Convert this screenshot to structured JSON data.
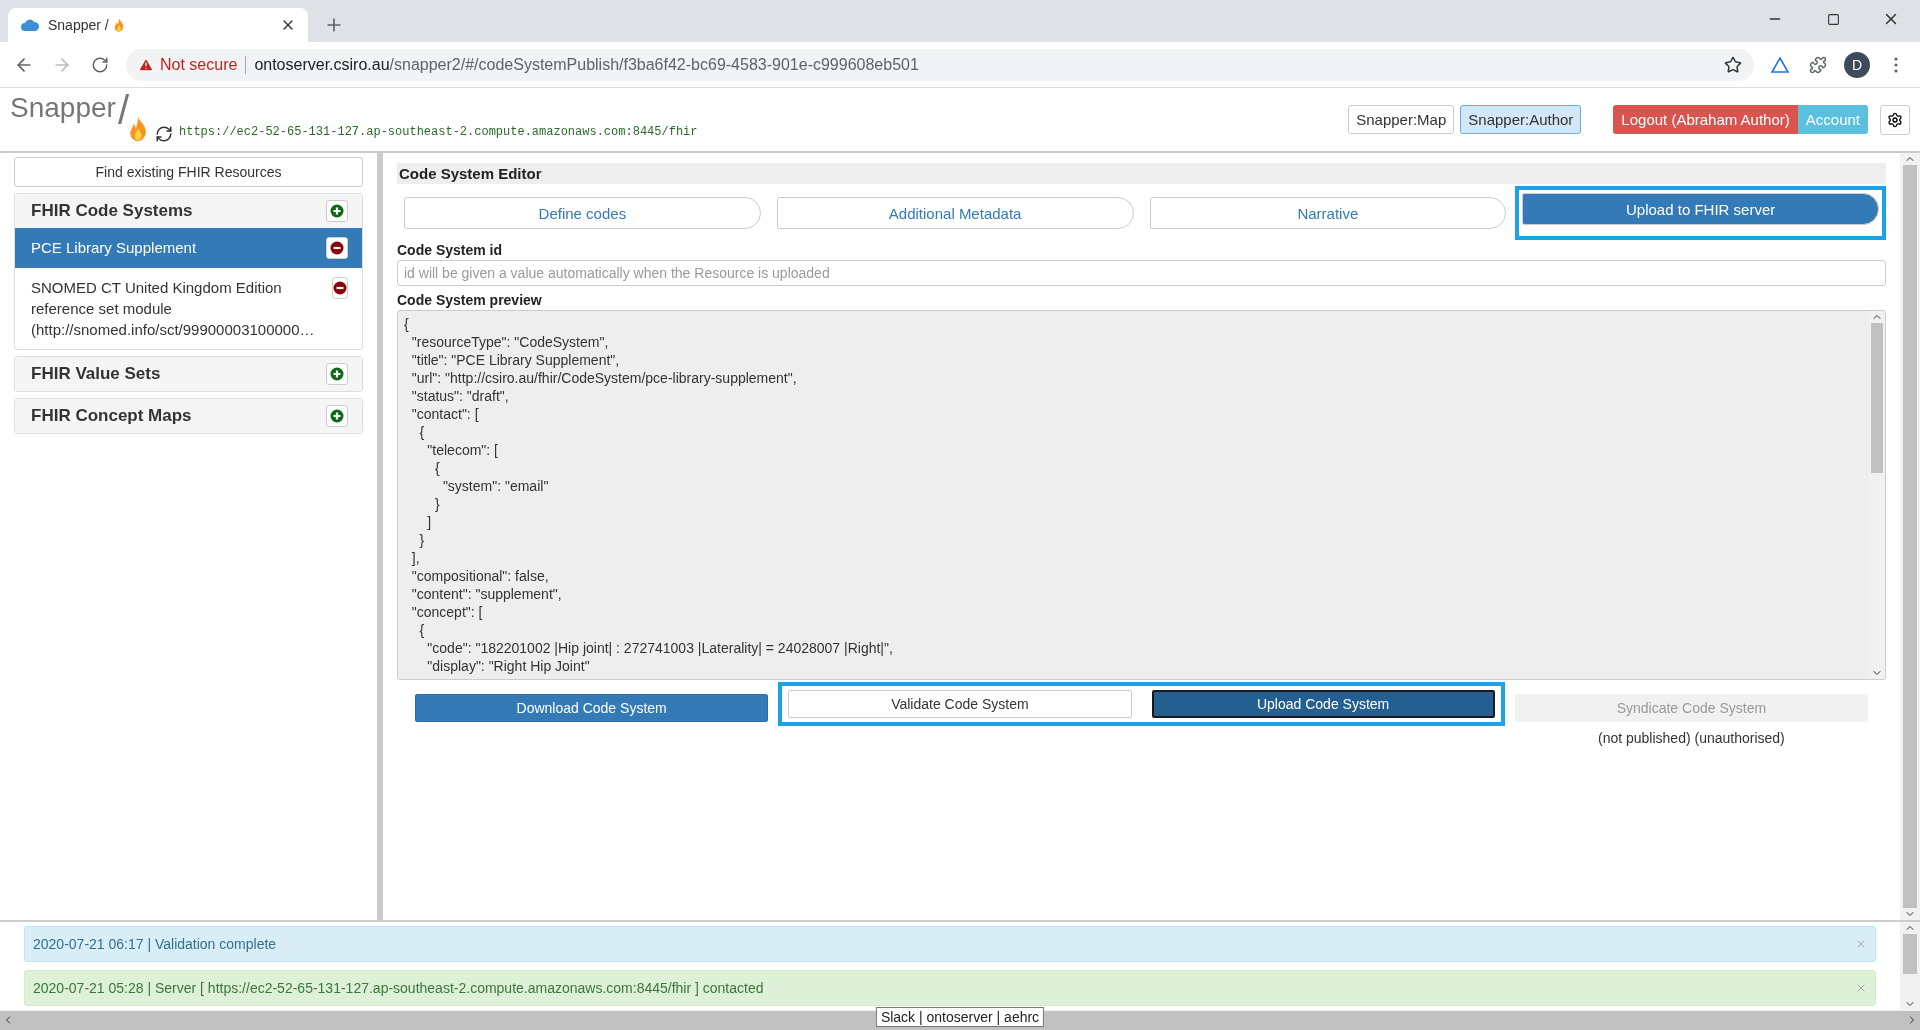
{
  "browser": {
    "tab_title": "Snapper /",
    "security": "Not secure",
    "url_host": "ontoserver.csiro.au",
    "url_path": "/snapper2/#/codeSystemPublish/f3ba6f42-bc69-4583-901e-c999608eb501",
    "profile": "D"
  },
  "header": {
    "logo": "Snapper",
    "logo_slash": "/",
    "server_url": "https://ec2-52-65-131-127.ap-southeast-2.compute.amazonaws.com:8445/fhir",
    "nav": [
      {
        "label": "Snapper:Map",
        "selected": false
      },
      {
        "label": "Snapper:Author",
        "selected": true
      }
    ],
    "logout": "Logout (Abraham Author)",
    "account": "Account"
  },
  "sidebar": {
    "find_button": "Find existing FHIR Resources",
    "sections": [
      {
        "title": "FHIR Code Systems",
        "items": [
          {
            "label": "PCE Library Supplement",
            "selected": true
          },
          {
            "label": "SNOMED CT United Kingdom Edition reference set module (http://snomed.info/sct/99900003100000…",
            "selected": false
          }
        ]
      },
      {
        "title": "FHIR Value Sets"
      },
      {
        "title": "FHIR Concept Maps"
      }
    ]
  },
  "editor": {
    "title": "Code System Editor",
    "tabs": [
      {
        "label": "Define codes",
        "selected": false,
        "highlighted": false
      },
      {
        "label": "Additional Metadata",
        "selected": false,
        "highlighted": false
      },
      {
        "label": "Narrative",
        "selected": false,
        "highlighted": false
      },
      {
        "label": "Upload to FHIR server",
        "selected": true,
        "highlighted": true
      }
    ],
    "id_label": "Code System id",
    "id_placeholder": "id will be given a value automatically when the Resource is uploaded",
    "preview_label": "Code System preview",
    "preview_lines": [
      "{",
      "  \"resourceType\": \"CodeSystem\",",
      "  \"title\": \"PCE Library Supplement\",",
      "  \"url\": \"http://csiro.au/fhir/CodeSystem/pce-library-supplement\",",
      "  \"status\": \"draft\",",
      "  \"contact\": [",
      "    {",
      "      \"telecom\": [",
      "        {",
      "          \"system\": \"email\"",
      "        }",
      "      ]",
      "    }",
      "  ],",
      "  \"compositional\": false,",
      "  \"content\": \"supplement\",",
      "  \"concept\": [",
      "    {",
      "      \"code\": \"182201002 |Hip joint| : 272741003 |Laterality| = 24028007 |Right|\",",
      "      \"display\": \"Right Hip Joint\""
    ],
    "button_groups": [
      {
        "highlighted": false,
        "buttons": [
          {
            "label": "Download Code System",
            "kind": "primary",
            "disabled": false
          }
        ]
      },
      {
        "highlighted": true,
        "buttons": [
          {
            "label": "Validate Code System",
            "kind": "default",
            "disabled": false
          },
          {
            "label": "Upload Code System",
            "kind": "dark",
            "disabled": false
          }
        ]
      },
      {
        "highlighted": false,
        "buttons": [
          {
            "label": "Syndicate Code System",
            "kind": "default",
            "disabled": true
          }
        ],
        "note": "(not published) (unauthorised)"
      }
    ]
  },
  "notifications": [
    {
      "text": "2020-07-21 06:17 | Validation complete",
      "kind": "info"
    },
    {
      "text": "2020-07-21 05:28 | Server [ https://ec2-52-65-131-127.ap-southeast-2.compute.amazonaws.com:8445/fhir ] contacted",
      "kind": "success"
    }
  ],
  "footer_tooltip": "Slack | ontoserver | aehrc"
}
